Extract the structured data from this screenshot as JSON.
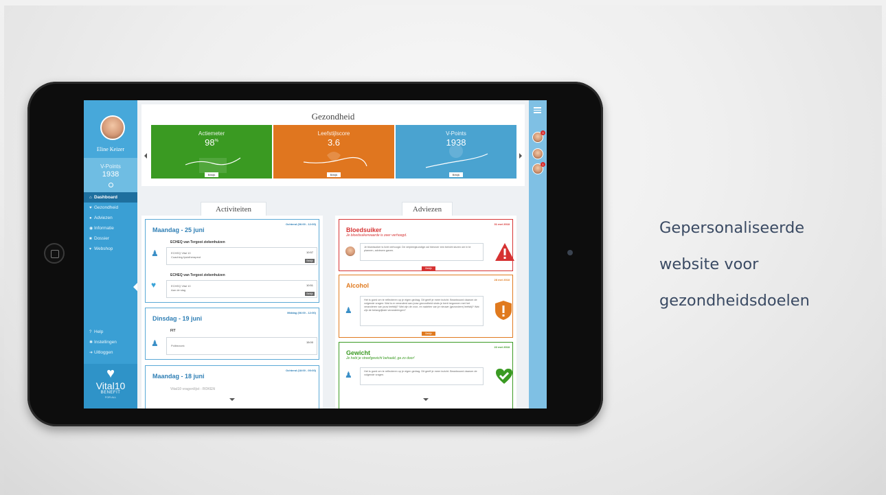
{
  "caption": {
    "line1": "Gepersonaliseerde",
    "line2": "website voor",
    "line3": "gezondheidsdoelen"
  },
  "sidebar": {
    "user_name": "Eline Keizer",
    "vpoints_label": "V-Points",
    "vpoints_value": "1938",
    "nav": [
      {
        "label": "Dashboard",
        "icon": "home-icon",
        "active": true
      },
      {
        "label": "Gezondheid",
        "icon": "heart-icon"
      },
      {
        "label": "Adviezen",
        "icon": "user-icon"
      },
      {
        "label": "Informatie",
        "icon": "info-icon"
      },
      {
        "label": "Dossier",
        "icon": "folder-icon"
      },
      {
        "label": "Webshop",
        "icon": "cart-icon"
      }
    ],
    "bottom_nav": [
      {
        "label": "Help",
        "icon": "question-icon"
      },
      {
        "label": "Instellingen",
        "icon": "gear-icon"
      },
      {
        "label": "Uitloggen",
        "icon": "logout-icon"
      }
    ],
    "brand_name": "Vital10",
    "brand_sub": "BENEFIT",
    "brand_sub2": "FOR ALL"
  },
  "health": {
    "title": "Gezondheid",
    "tiles": [
      {
        "label": "Actiemeter",
        "value": "98",
        "unit": "%",
        "button": "Bekijk",
        "color": "#3a9a22"
      },
      {
        "label": "Leefstijlscore",
        "value": "3.6",
        "button": "Bekijk",
        "color": "#e0761f"
      },
      {
        "label": "V-Points",
        "value": "1938",
        "button": "Bekijk",
        "color": "#4aa3d0"
      }
    ]
  },
  "activities": {
    "title": "Activiteiten",
    "days": [
      {
        "title": "Maandag - 25 juni",
        "time": "Ochtend (06:00 - 12:00)",
        "groups": [
          {
            "group": "ECHEQ van Tergooi ziekenhuizen",
            "line1": "ECHEQ Vital 10",
            "line2": "Coaching fysiotherapeut",
            "time": "10:57",
            "button": "Bekijk"
          },
          {
            "group": "ECHEQ van Tergooi ziekenhuizen",
            "line1": "ECHEQ Vital 10",
            "line2": "Aan de slag",
            "time": "10:51",
            "button": "Bekijk"
          }
        ]
      },
      {
        "title": "Dinsdag - 19 juni",
        "time": "Middag (06:00 - 12:00)",
        "groups": [
          {
            "group": "FIT",
            "line1": "Polibezoek",
            "line2": "",
            "time": "15:00",
            "button": ""
          }
        ]
      },
      {
        "title": "Maandag - 18 juni",
        "time": "Ochtend (18:00 - 00:00)",
        "groups": [
          {
            "group": "Vital10 vragenlijst - ROKEN"
          }
        ]
      }
    ]
  },
  "advice": {
    "title": "Adviezen",
    "items": [
      {
        "title": "Bloedsuiker",
        "subtitle": "Je bloedsuikerwaarde is zeer verhoogd.",
        "date": "31 mei 2018",
        "text": "Je bloedsuiker is licht verhoogd. De verpleegkundige zal hierover een bericht sturen om in te plannen, adviezen gaven.",
        "button": "Bekijk",
        "color": "#d63232",
        "icon": "warning-triangle-icon"
      },
      {
        "title": "Alcohol",
        "subtitle": "",
        "date": "28 mei 2018",
        "text": "Het is goed om te reflecteren op je eigen gedrag. Dit geeft je meer inzicht. Beantwoord daarom de volgende vragen: Wat is er veranderd aan jouw gezondheid sinds je bent begonnen met het veranderen van jouw leefstijl? Wat zijn de voor- en nadelen van je nieuwe (gezondere) leefstijl? Wat zijn de belangrijkste veranderingen?",
        "button": "Bekijk",
        "color": "#e07a1f",
        "icon": "exclamation-shield-icon"
      },
      {
        "title": "Gewicht",
        "subtitle": "Je hebt je streefgewicht behaald, ga zo door!",
        "date": "22 mei 2018",
        "text": "Het is goed om te reflecteren op je eigen gedrag. Dit geeft je meer inzicht. Beantwoord daarom de volgende vragen.",
        "button": "",
        "color": "#3a9a22",
        "icon": "checkmark-heart-icon"
      }
    ]
  },
  "rail": {
    "avatars": [
      {
        "badge": "3"
      },
      {
        "badge": ""
      },
      {
        "badge": "1"
      }
    ]
  }
}
